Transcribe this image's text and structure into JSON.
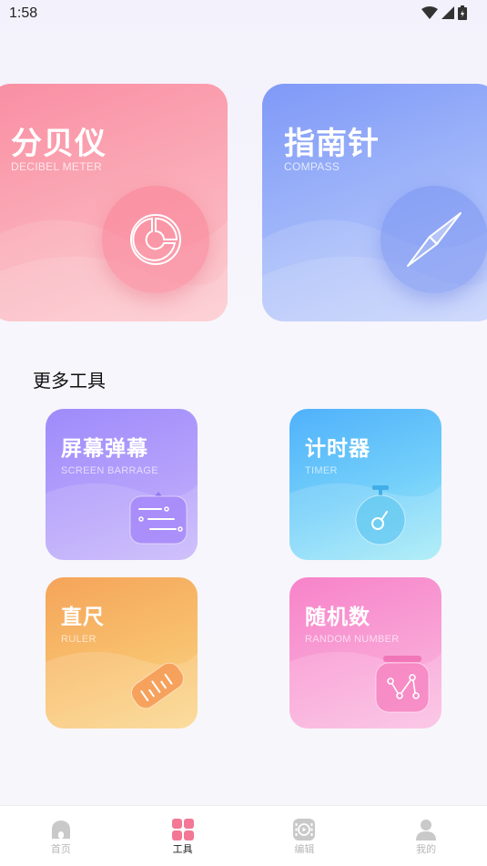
{
  "status_bar": {
    "time": "1:58"
  },
  "cards": {
    "decibel": {
      "title": "分贝仪",
      "subtitle": "DECIBEL METER"
    },
    "compass": {
      "title": "指南针",
      "subtitle": "COMPASS"
    }
  },
  "section": {
    "title": "更多工具"
  },
  "tools": {
    "barrage": {
      "title": "屏幕弹幕",
      "subtitle": "SCREEN BARRAGE"
    },
    "timer": {
      "title": "计时器",
      "subtitle": "TIMER"
    },
    "ruler": {
      "title": "直尺",
      "subtitle": "RULER"
    },
    "random": {
      "title": "随机数",
      "subtitle": "RANDOM NUMBER"
    }
  },
  "tabbar": {
    "items": [
      {
        "label": "首页",
        "icon": "home-icon"
      },
      {
        "label": "工具",
        "icon": "grid-icon",
        "active": true
      },
      {
        "label": "编辑",
        "icon": "video-edit-icon"
      },
      {
        "label": "我的",
        "icon": "user-icon"
      }
    ]
  },
  "colors": {
    "decibel": "#f98ea3",
    "compass": "#7f99f7",
    "barrage": "#a992fb",
    "timer": "#4fb1fb",
    "ruler": "#f5a45a",
    "random": "#f783c9",
    "tab_active": "#f27896"
  }
}
